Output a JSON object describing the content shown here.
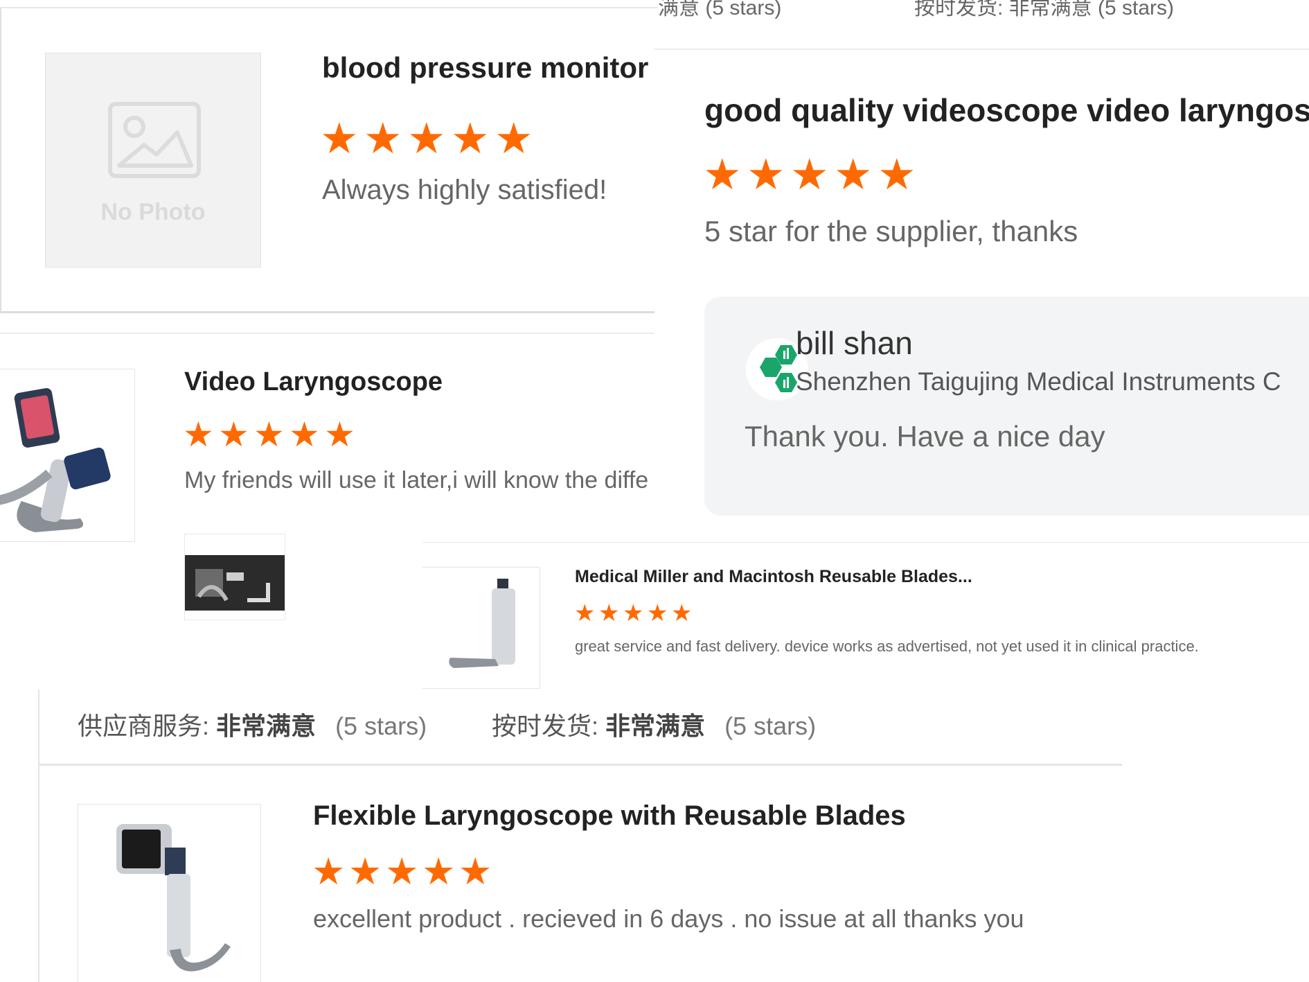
{
  "top_strip": {
    "left_fragment": "满意  (5 stars)",
    "right_fragment": "按时发货: 非常满意  (5 stars)"
  },
  "review1": {
    "product": "blood pressure monitor",
    "rating": 5,
    "text": "Always highly satisfied!",
    "photo_placeholder": "No Photo"
  },
  "review2": {
    "product": "good quality videoscope video laryngosc",
    "rating": 5,
    "text": "5 star for the supplier, thanks",
    "reply": {
      "name": "bill shan",
      "company": "Shenzhen Taigujing Medical Instruments C",
      "message": "Thank you. Have a nice day"
    }
  },
  "review3": {
    "product": "Video Laryngoscope",
    "rating": 5,
    "text": "My friends will use it later,i will know the diffe"
  },
  "review4": {
    "product": "Medical Miller and Macintosh Reusable Blades...",
    "rating": 5,
    "text": "great service and fast delivery. device works as advertised, not yet used it in clinical practice."
  },
  "ratings_line": {
    "supplier_label": "供应商服务:",
    "supplier_value": "非常满意",
    "supplier_stars": "(5 stars)",
    "shipping_label": "按时发货:",
    "shipping_value": "非常满意",
    "shipping_stars": "(5 stars)"
  },
  "review5": {
    "product": "Flexible Laryngoscope with Reusable Blades",
    "rating": 5,
    "text": "excellent product . recieved in 6 days . no issue at all thanks you"
  },
  "colors": {
    "star": "#ff6a00",
    "reply_bg": "#f3f4f5",
    "avatar": "#1aa56b"
  }
}
